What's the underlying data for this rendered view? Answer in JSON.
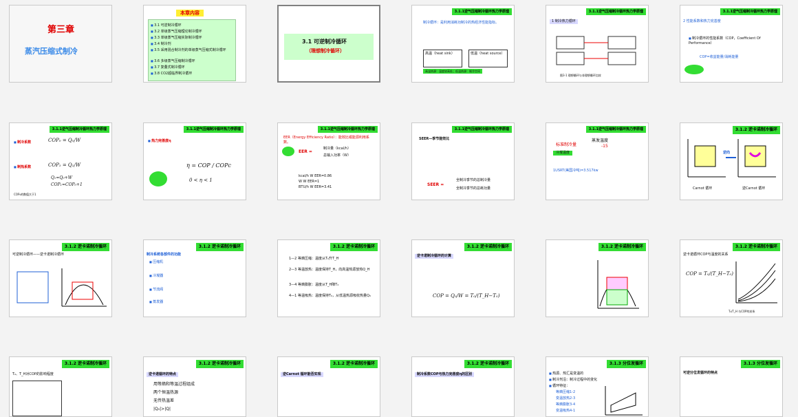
{
  "slides": {
    "s1": {
      "title": "第三章",
      "subtitle": "蒸汽压缩式制冷"
    },
    "s2": {
      "title": "本章内容",
      "items": [
        "3.1  可逆制冷循环",
        "3.2  单级蒸气压缩理论制冷循环",
        "3.3  单级蒸气压缩实际制冷循环",
        "3.4  制冷剂",
        "3.5  采用混合制冷剂的单级蒸气压缩式制冷循环",
        "3.6  多级蒸气压缩制冷循环",
        "3.7  复叠式制冷循环",
        "3.8  CO2超临界制冷循环"
      ]
    },
    "s3": {
      "title": "3.1  可逆制冷循环",
      "subtitle": "（理想制冷循环）"
    },
    "s4": {
      "hdr": "3.1.1逆气压缩制冷循环热力学原理",
      "line1": "制冷循环：是利用消耗功制冷的热经济性能指标。",
      "box1": "高温（heat sink）",
      "box2": "低温（heat source）",
      "note": "高温热源：温度较高处；低温热源：制冷空间"
    },
    "s5": {
      "hdr": "3.1.1逆气压缩制冷循环热力学原理",
      "line1": "1 制冷热力循环",
      "caption": "图3-1  理想循环与非理想循环比较"
    },
    "s6": {
      "hdr": "3.1.1逆气压缩制冷循环热力学原理",
      "line1": "2 性能系数和热力完善度",
      "line2": "制冷循环的性能系数（COP，Coefficient Of Performance）",
      "line3": "COP=收益能量/消耗能量"
    },
    "s7": {
      "hdr": "3.1.1逆气压缩制冷循环热力学原理",
      "label1": "制冷系数",
      "f1": "COP₀ = Q₀/W",
      "label2": "制热系数",
      "f2": "COP₁ = Q₁/W",
      "f3": "Q₁=Q₀+W",
      "f4": "COP₁=COP₀+1",
      "note": "COP₀的数值大于1"
    },
    "s8": {
      "hdr": "3.1.1逆气压缩制冷循环热力学原理",
      "label": "热力完善度η",
      "formula": "η = COP / COPc",
      "range": "0 < η < 1"
    },
    "s9": {
      "hdr": "3.1.1逆气压缩制冷循环热力学原理",
      "title": "EER（Energy Efficiency Ratio）：能效比或能源利用系数。",
      "eer": "EER =",
      "num": "制冷量（kcal/h）",
      "den": "总输入功率（W）",
      "r1": "kcal/h      W       EER=0.86",
      "r2": "W         W       EER=1",
      "r3": "BTU/h      W       EER=3.41"
    },
    "s10": {
      "hdr": "3.1.1逆气压缩制冷循环热力学原理",
      "title": "SEER—季节能效比",
      "seer": "SEER =",
      "num": "全制冷季节的总制冷量",
      "den": "全制冷季节的总耗功量"
    },
    "s11": {
      "hdr": "3.1.1逆气压缩制冷循环热力学原理",
      "l1": "标准制冷量",
      "l2": "蒸发温度",
      "l3": "-15",
      "l4": "冷凝温度",
      "l5": "1USRT(美国冷吨)=3.517kw"
    },
    "s12": {
      "hdr": "3.1.2 逆卡诺制冷循环",
      "cap1": "Carnot 循环",
      "cap2": "逆Carnot 循环",
      "arrow": "逆向"
    },
    "s13": {
      "hdr": "3.1.2 逆卡诺制冷循环",
      "title": "可逆制冷循环——逆卡诺制冷循环"
    },
    "s14": {
      "hdr": "3.1.2 逆卡诺制冷循环",
      "title": "制冷系统各部件的功能",
      "items": [
        "压缩机",
        "冷凝器",
        "节流阀",
        "蒸发器"
      ]
    },
    "s15": {
      "hdr": "3.1.2 逆卡诺制冷循环",
      "items": [
        "1—2  等熵压缩：温度从T₀升T_H",
        "2—3  等温放热：温度保持T_H，向高温热源放热Q_H",
        "3—4  等熵膨胀：温度从T_H降T₀",
        "4—1  等温吸热：温度保持T₀，从低温热源吸收热量Q₀"
      ]
    },
    "s16": {
      "hdr": "3.1.2 逆卡诺制冷循环",
      "title": "逆卡诺制冷循环的计算",
      "formula": "COP = Q₀/W = T₀/(T_H−T₀)"
    },
    "s17": {
      "hdr": "3.1.2 逆卡诺制冷循环"
    },
    "s18": {
      "hdr": "3.1.2 逆卡诺制冷循环",
      "title": "逆卡诺循环COP与温度的关系",
      "formula": "COP = T₀/(T_H−T₀)",
      "caption": "T₀/T_H 与COP的关系"
    },
    "s19": {
      "hdr": "3.1.2 逆卡诺制冷循环",
      "title": "T₀、T_H对COP的影响程度"
    },
    "s20": {
      "hdr": "3.1.2 逆卡诺制冷循环",
      "title": "逆卡诺循环的特点",
      "items": [
        "用等熵和等温过程组成",
        "两个恒温热源",
        "无传热温差",
        "|Q₀|>|Q|"
      ]
    },
    "s21": {
      "hdr": "3.1.2 逆卡诺制冷循环",
      "title": "逆Carnot 循环能否实现"
    },
    "s22": {
      "hdr": "3.1.2 逆卡诺制冷循环",
      "title": "制冷系数COP与热力完善度η的区别"
    },
    "s23": {
      "hdr": "3.1.3 分位发循环",
      "items": [
        "热源、热汇是变温的",
        "制冷剂沿：制冷过程中的变化",
        "循环特征："
      ],
      "sub": [
        "等熵压缩1-2",
        "变温放热2-3",
        "等熵膨胀3-4",
        "变温吸热4-1"
      ]
    },
    "s24": {
      "hdr": "3.1.3 分位发循环",
      "title": "可逆分位发循环的特点"
    }
  }
}
